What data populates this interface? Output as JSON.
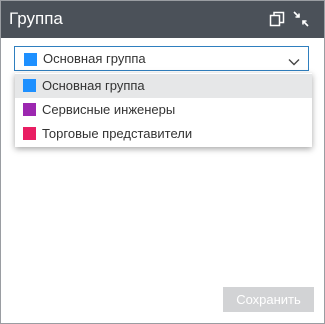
{
  "window": {
    "title": "Группа",
    "icons": [
      "copy-icon",
      "collapse-icon"
    ]
  },
  "group_select": {
    "selected_label": "Основная группа",
    "selected_color": "#1e90ff",
    "chevron_icon": "chevron-down-icon"
  },
  "dropdown": {
    "options": [
      {
        "label": "Основная группа",
        "color": "#1e90ff",
        "selected": true
      },
      {
        "label": "Сервисные инженеры",
        "color": "#9c27b0",
        "selected": false
      },
      {
        "label": "Торговые представители",
        "color": "#e91e63",
        "selected": false
      }
    ]
  },
  "footer": {
    "save_label": "Сохранить",
    "save_enabled": false
  },
  "colors": {
    "header_bg": "#4b5159",
    "select_border": "#2f7fbf",
    "option_highlight": "#e6e7e8",
    "disabled_button": "#d2d3d5"
  }
}
